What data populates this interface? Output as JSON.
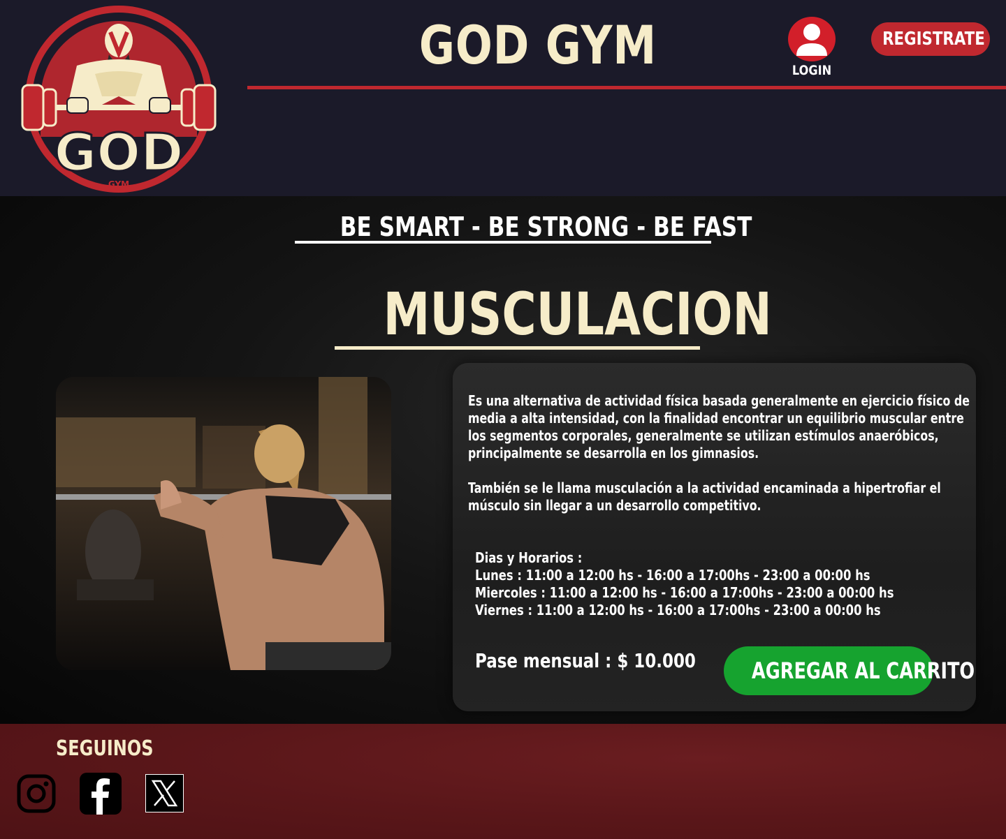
{
  "header": {
    "logo_text": "GOD",
    "logo_subtext": "GYM",
    "title": "GOD GYM",
    "login_label": "LOGIN",
    "register_label": "REGISTRATE",
    "accent_color": "#c0282f",
    "login_icon": "user-icon"
  },
  "main": {
    "tagline": "BE SMART - BE STRONG - BE FAST",
    "section_title": "MUSCULACION",
    "photo_alt": "woman-squatting-barbell-photo",
    "description_1": "Es una alternativa de actividad física basada generalmente en ejercicio físico de media a alta intensidad, con la finalidad encontrar un equilibrio muscular entre los segmentos corporales, generalmente se utilizan estímulos anaeróbicos, principalmente se desarrolla en los gimnasios.",
    "description_2": "También se le llama musculación a la actividad encaminada a hipertrofiar el músculo sin llegar a un desarrollo competitivo.",
    "schedule_title": "Dias y Horarios :",
    "schedule": [
      "Lunes : 11:00 a 12:00 hs - 16:00 a 17:00hs - 23:00 a 00:00 hs",
      "Miercoles : 11:00 a 12:00 hs - 16:00 a 17:00hs - 23:00 a 00:00 hs",
      "Viernes :  11:00 a 12:00 hs - 16:00 a 17:00hs - 23:00 a 00:00 hs"
    ],
    "price": "Pase mensual : $ 10.000",
    "cart_button": "AGREGAR AL CARRITO",
    "cart_color": "#16a32f"
  },
  "footer": {
    "follow_label": "SEGUINOS",
    "social": [
      "instagram-icon",
      "facebook-icon",
      "x-icon"
    ]
  }
}
